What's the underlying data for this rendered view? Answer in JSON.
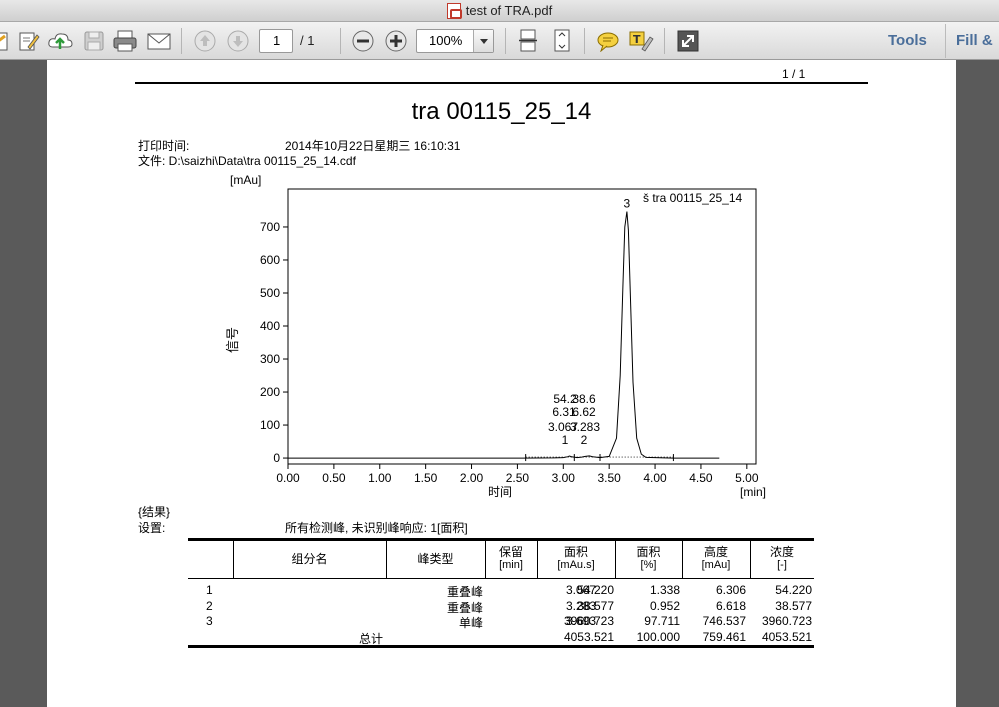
{
  "window": {
    "title": "test of TRA.pdf"
  },
  "toolbar": {
    "page_current": "1",
    "page_total": "/ 1",
    "zoom": "100%",
    "tools_label": "Tools",
    "fill_label": "Fill &"
  },
  "document": {
    "page_indicator": "1 / 1",
    "title": "tra 00115_25_14",
    "print_time_label": "打印时间:",
    "print_time_value": "2014年10月22日星期三 16:10:31",
    "file_line": "文件: D:\\saizhi\\Data\\tra 00115_25_14.cdf",
    "results_label": "{结果}",
    "settings_label": "设置:",
    "settings_value": "所有检测峰, 未识别峰响应: 1[面积]"
  },
  "chart_data": {
    "type": "line",
    "legend": "š  tra 00115_25_14",
    "xlabel": "时间",
    "xunit": "[min]",
    "ylabel": "信号",
    "yunit": "[mAu]",
    "xlim": [
      0,
      5.1
    ],
    "ylim": [
      -18,
      815
    ],
    "xticks": [
      "0.00",
      "0.50",
      "1.00",
      "1.50",
      "2.00",
      "2.50",
      "3.00",
      "3.50",
      "4.00",
      "4.50",
      "5.00"
    ],
    "yticks": [
      "0",
      "100",
      "200",
      "300",
      "400",
      "500",
      "600",
      "700"
    ],
    "series": [
      {
        "x": [
          0,
          2.55,
          2.9,
          3.0,
          3.05,
          3.067,
          3.09,
          3.15,
          3.2,
          3.24,
          3.283,
          3.32,
          3.4,
          3.5,
          3.58,
          3.62,
          3.65,
          3.67,
          3.693,
          3.71,
          3.73,
          3.76,
          3.8,
          3.85,
          3.9,
          4.2,
          4.7
        ],
        "y": [
          0,
          0,
          0.5,
          1.5,
          4,
          6.3,
          4,
          1.5,
          3,
          5,
          6.6,
          4,
          1.5,
          5,
          60,
          250,
          520,
          700,
          746.5,
          690,
          500,
          230,
          60,
          12,
          2,
          0,
          0
        ]
      }
    ],
    "peak_labels": [
      {
        "id": "1",
        "rt": "3.067",
        "height": "6.31",
        "area": "54.2"
      },
      {
        "id": "2",
        "rt": "3.283",
        "height": "6.62",
        "area": "38.6"
      },
      {
        "id": "3",
        "rt": "3.693",
        "height": "746.537",
        "area": "3960.723"
      }
    ],
    "integration_marks_x": [
      2.59,
      3.12,
      3.4,
      4.2
    ]
  },
  "results_table": {
    "headers": [
      {
        "line1": "",
        "line2": ""
      },
      {
        "line1": "组分名",
        "line2": ""
      },
      {
        "line1": "峰类型",
        "line2": ""
      },
      {
        "line1": "保留",
        "line2": "[min]"
      },
      {
        "line1": "面积",
        "line2": "[mAu.s]"
      },
      {
        "line1": "面积",
        "line2": "[%]"
      },
      {
        "line1": "高度",
        "line2": "[mAu]"
      },
      {
        "line1": "浓度",
        "line2": "[-]"
      }
    ],
    "rows": [
      [
        "1",
        "",
        "重叠峰",
        "3.067",
        "54.220",
        "1.338",
        "6.306",
        "54.220"
      ],
      [
        "2",
        "",
        "重叠峰",
        "3.283",
        "38.577",
        "0.952",
        "6.618",
        "38.577"
      ],
      [
        "3",
        "",
        "单峰",
        "3.693",
        "3960.723",
        "97.711",
        "746.537",
        "3960.723"
      ]
    ],
    "total": {
      "label": "总计",
      "area": "4053.521",
      "area_pct": "100.000",
      "height": "759.461",
      "conc": "4053.521"
    }
  }
}
